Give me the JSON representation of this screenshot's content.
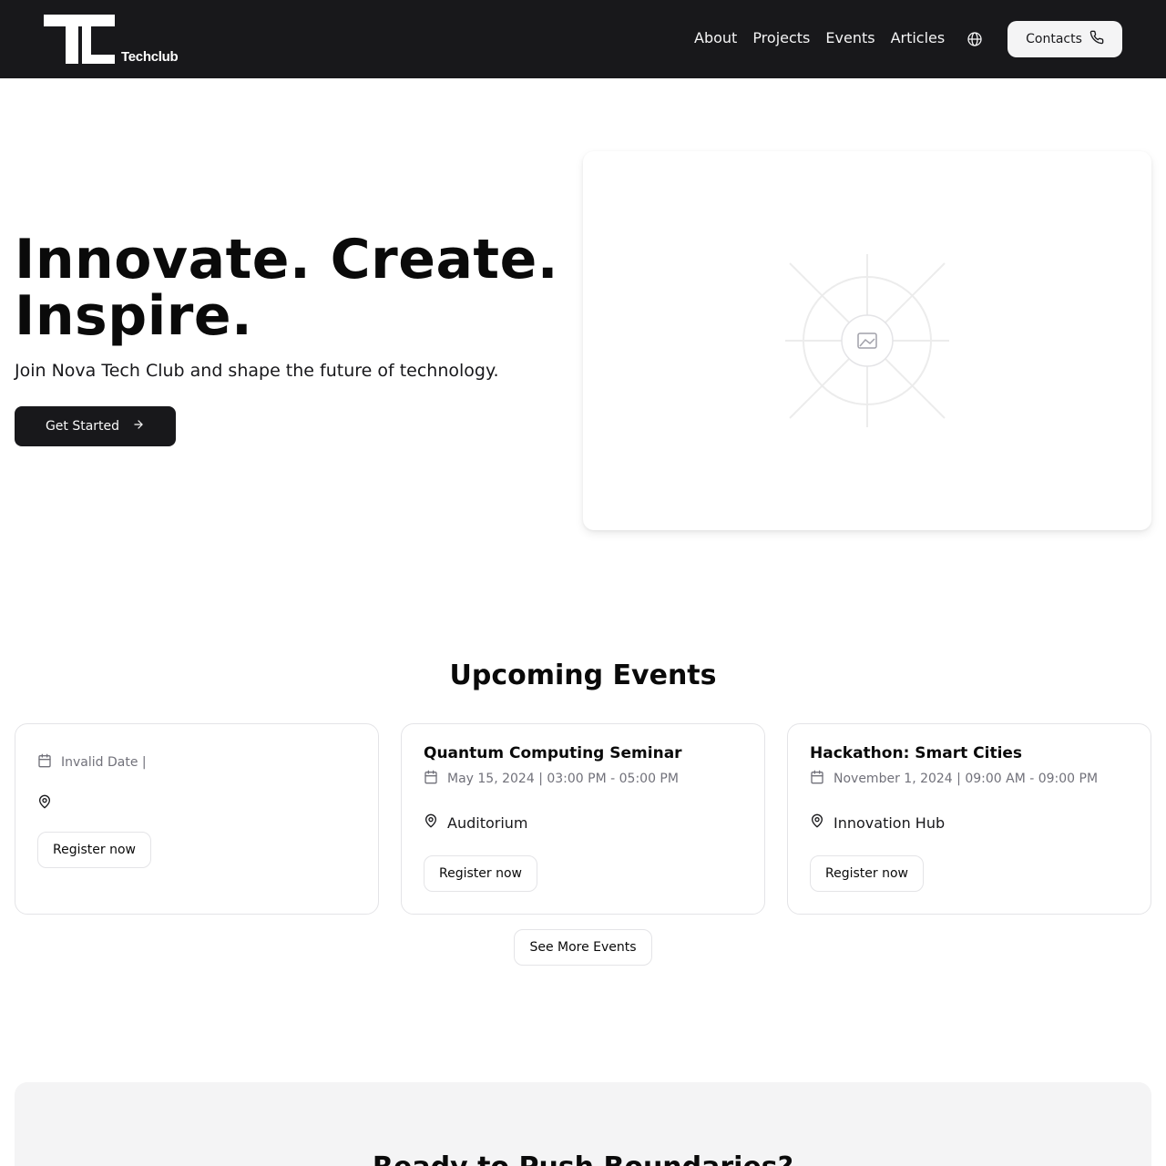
{
  "header": {
    "logo_text": "Techclub",
    "nav": [
      "About",
      "Projects",
      "Events",
      "Articles"
    ],
    "language_icon": "globe-icon",
    "contacts_label": "Contacts",
    "contacts_icon": "phone-icon"
  },
  "hero": {
    "title_line1": "Innovate. Create.",
    "title_line2": "Inspire.",
    "subtitle": "Join Nova Tech Club and shape the future of technology.",
    "cta_label": "Get Started",
    "cta_icon": "arrow-right-icon",
    "image_icon": "image-placeholder-icon"
  },
  "events": {
    "title": "Upcoming Events",
    "cards": [
      {
        "title": "",
        "date": "Invalid Date |",
        "location": "",
        "register_label": "Register now"
      },
      {
        "title": "Quantum Computing Seminar",
        "date": "May 15, 2024 | 03:00 PM - 05:00 PM",
        "location": "Auditorium",
        "register_label": "Register now"
      },
      {
        "title": "Hackathon: Smart Cities",
        "date": "November 1, 2024 | 09:00 AM - 09:00 PM",
        "location": "Innovation Hub",
        "register_label": "Register now"
      }
    ],
    "more_label": "See More Events"
  },
  "banner": {
    "title": "Ready to Push Boundaries?"
  },
  "colors": {
    "header_bg": "#18181b",
    "primary": "#18181b",
    "muted_text": "#71717a",
    "border": "#e4e4e7",
    "banner_bg": "#f4f4f5"
  }
}
